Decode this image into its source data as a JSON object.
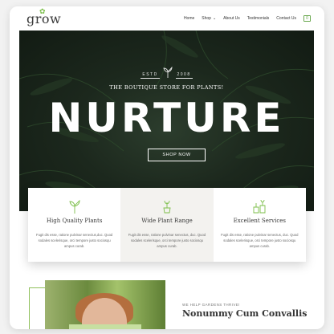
{
  "brand": {
    "logo_text": "grow",
    "accent": "#7cbf4a"
  },
  "nav": {
    "items": [
      {
        "label": "Home"
      },
      {
        "label": "Shop"
      },
      {
        "label": "About Us"
      },
      {
        "label": "Testimonials"
      },
      {
        "label": "Contact Us"
      }
    ],
    "cart_count": "0"
  },
  "hero": {
    "estd_left": "ESTD",
    "estd_right": "2008",
    "tagline": "THE BOUTIQUE STORE FOR PLANTS!",
    "headline": "NURTURE",
    "button_label": "SHOP NOW"
  },
  "features": [
    {
      "icon": "sprout-icon",
      "title": "High Quality Plants",
      "desc": "Fugit dis esse, ratione pulvinar senectus,duc. Quod sodales scelerisque, orci tempore justo sociosqu ampus curab."
    },
    {
      "icon": "potted-plant-icon",
      "title": "Wide Plant Range",
      "desc": "Fugit dis esse, ratione pulvinar senectus, duc. Quod sodales scelerisque, orci tempore justo sociosqu ampus curab."
    },
    {
      "icon": "plant-service-icon",
      "title": "Excellent Services",
      "desc": "Fugit dis esse, ratione pulvinar senectus, duc. Quod sodales scelerisque, orci tempore justo sociosqu ampus curab."
    }
  ],
  "about": {
    "kicker": "WE HELP GARDENS THRIVE!",
    "title": "Nonummy Cum Convallis"
  }
}
